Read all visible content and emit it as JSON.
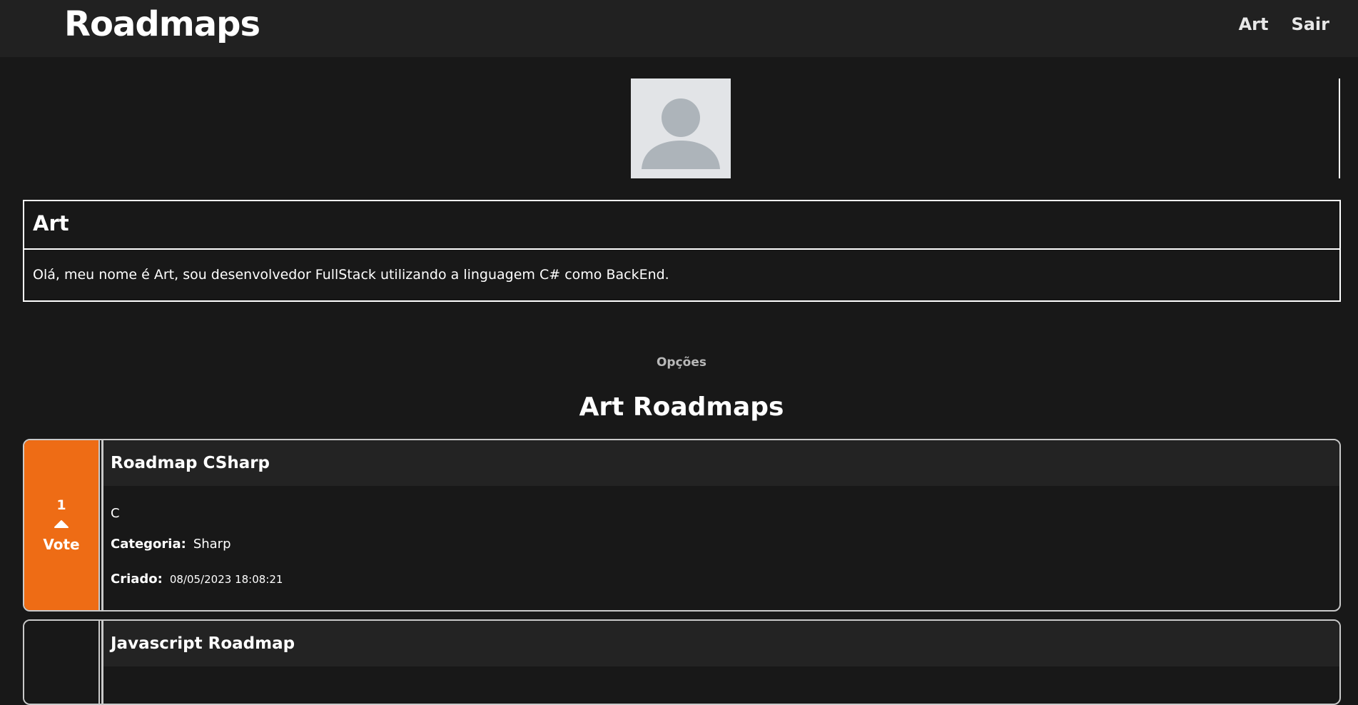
{
  "header": {
    "brand": "Roadmaps",
    "nav": [
      {
        "label": "Art"
      },
      {
        "label": "Sair"
      }
    ]
  },
  "profile": {
    "name": "Art",
    "bio": "Olá, meu nome é Art, sou desenvolvedor FullStack utilizando a linguagem C# como BackEnd."
  },
  "options_label": "Opções",
  "section_title": "Art Roadmaps",
  "roadmaps": [
    {
      "title": "Roadmap CSharp",
      "votes": "1",
      "vote_label": "Vote",
      "description": "C",
      "category_label": "Categoria:",
      "category": "Sharp",
      "created_label": "Criado:",
      "created": "08/05/2023 18:08:21"
    },
    {
      "title": "Javascript Roadmap"
    }
  ],
  "colors": {
    "background": "#181818",
    "header": "#212121",
    "accent": "#ee6c15",
    "avatar_bg": "#e2e4e7",
    "avatar_fg": "#adb4ba"
  },
  "icons": {
    "avatar": "user-placeholder-icon",
    "vote": "caret-up-icon"
  }
}
